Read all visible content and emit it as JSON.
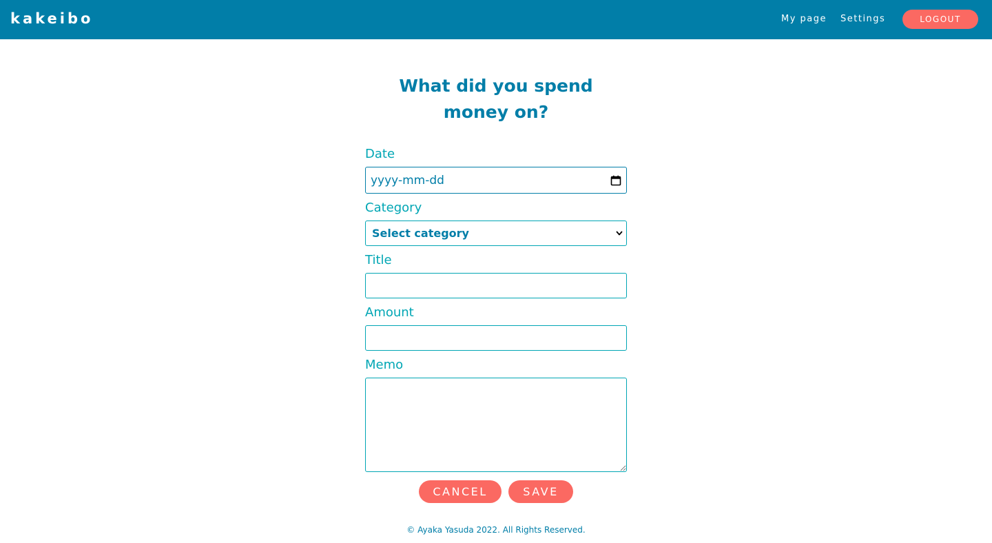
{
  "navbar": {
    "brand": "kakeibo",
    "links": {
      "my_page": "My page",
      "settings": "Settings"
    },
    "logout_label": "LOGOUT"
  },
  "form": {
    "title_line1": "What did you spend",
    "title_line2": "money on?",
    "date": {
      "label": "Date",
      "value": "yyyy-mm-dd",
      "icon": "calendar-icon"
    },
    "category": {
      "label": "Category",
      "selected": "Select category",
      "icon": "chevron-down-icon"
    },
    "title": {
      "label": "Title",
      "value": ""
    },
    "amount": {
      "label": "Amount",
      "value": ""
    },
    "memo": {
      "label": "Memo",
      "value": ""
    },
    "cancel_label": "CANCEL",
    "save_label": "SAVE"
  },
  "footer": {
    "copyright": "© Ayaka Yasuda 2022. All Rights Reserved."
  },
  "colors": {
    "navbar_bg": "#017ea8",
    "accent_teal": "#00a6b4",
    "button_coral": "#fb6962",
    "text_white": "#ffffff"
  }
}
